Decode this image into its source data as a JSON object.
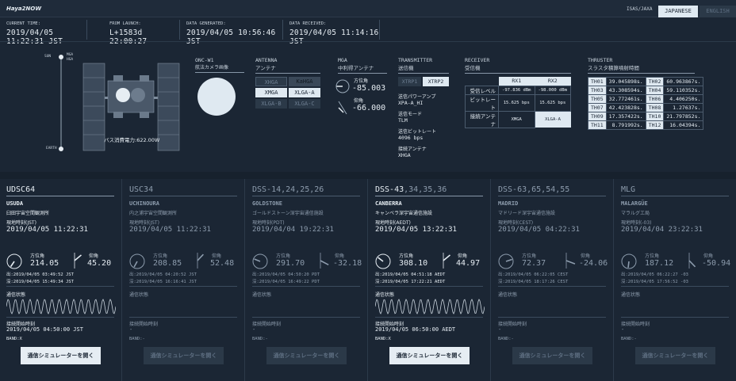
{
  "header": {
    "app_title": "Haya2NOW",
    "org": "ISAS/JAXA",
    "lang_ja": "JAPANESE",
    "lang_en": "ENGLISH"
  },
  "times": [
    {
      "label": "CURRENT TIME:",
      "value": "2019/04/05 11:22:31 JST"
    },
    {
      "label": "FROM LAUNCH:",
      "value": "L+1583d 22:00:27"
    },
    {
      "label": "DATA GENERATED:",
      "value": "2019/04/05 10:56:46 JST"
    },
    {
      "label": "DATA RECEIVED:",
      "value": "2019/04/05 11:14:16 JST"
    }
  ],
  "spacecraft": {
    "label_sun": "SUN",
    "label_mga": "MGA",
    "label_hga": "HGA",
    "label_earth": "EARTH",
    "power": "バス消費電力:622.00W"
  },
  "onc": {
    "title": "ONC-W1",
    "subtitle": "航法カメラ画像"
  },
  "antenna": {
    "title": "ANTENNA",
    "subtitle": "アンテナ",
    "buttons": [
      {
        "label": "XHGA",
        "state": "off"
      },
      {
        "label": "KaHGA",
        "state": "dim"
      },
      {
        "label": "XMGA",
        "state": "on"
      },
      {
        "label": "XLGA-A",
        "state": "on"
      },
      {
        "label": "XLGA-B",
        "state": "off"
      },
      {
        "label": "XLGA-C",
        "state": "off"
      }
    ]
  },
  "mga": {
    "title": "MGA",
    "subtitle": "中利得アンテナ",
    "az_label": "方位角",
    "az_value": "-85.003",
    "el_label": "仰角",
    "el_value": "-66.000"
  },
  "transmitter": {
    "title": "TRANSMITTER",
    "subtitle": "送信機",
    "xtrp1": "XTRP1",
    "xtrp2": "XTRP2",
    "power_label": "送信パワーアンプ",
    "power_value": "XPA-A_HI",
    "mode_label": "送信モード",
    "mode_value": "TLM",
    "bitrate_label": "送信ビットレート",
    "bitrate_value": "4096 bps",
    "antenna_label": "接続アンテナ",
    "antenna_value": "XHGA"
  },
  "receiver": {
    "title": "RECEIVER",
    "subtitle": "受信機",
    "col1": "RX1",
    "col2": "RX2",
    "rows": [
      {
        "label": "受信レベル",
        "rx1": "-97.836 dBm",
        "rx2": "-98.000 dBm"
      },
      {
        "label": "ビットレート",
        "rx1": "15.625 bps",
        "rx2": "15.625 bps"
      },
      {
        "label": "接続アンテナ",
        "rx1": "XMGA",
        "rx2": "XLGA-A"
      }
    ]
  },
  "thruster": {
    "title": "THRUSTER",
    "subtitle": "スラスタ積算噴射時間",
    "rows": [
      [
        {
          "id": "TH01",
          "v": "39.045898s."
        },
        {
          "id": "TH02",
          "v": "60.963867s."
        }
      ],
      [
        {
          "id": "TH03",
          "v": "43.308594s."
        },
        {
          "id": "TH04",
          "v": "59.110352s."
        }
      ],
      [
        {
          "id": "TH05",
          "v": "32.772461s."
        },
        {
          "id": "TH06",
          "v": "4.406250s."
        }
      ],
      [
        {
          "id": "TH07",
          "v": "42.423828s."
        },
        {
          "id": "TH08",
          "v": "1.27637s."
        }
      ],
      [
        {
          "id": "TH09",
          "v": "17.357422s."
        },
        {
          "id": "TH10",
          "v": "21.797852s."
        }
      ],
      [
        {
          "id": "TH11",
          "v": "8.791992s."
        },
        {
          "id": "TH12",
          "v": "16.04394s."
        }
      ]
    ]
  },
  "stations": [
    {
      "code": "UDSC64",
      "name": "USUDA",
      "jname": "臼田宇宙空間観測所",
      "tz": "現地時刻(JST)",
      "local_time": "2019/04/05 11:22:31",
      "az_label": "方位角",
      "az": "214.05",
      "el_label": "仰角",
      "el": "45.20",
      "rise": "出:2019/04/05 03:49:52 JST",
      "set": "沒:2019/04/05 15:49:34 JST",
      "comm_label": "通信状態",
      "start_label": "接続開始時刻",
      "start": "2019/04/05 04:50:00 JST",
      "band": "BAND:X",
      "sim_button": "通信シミュレーターを開く",
      "active": true,
      "az_deg": 214,
      "el_deg": 45
    },
    {
      "code": "USC34",
      "name": "UCHINOURA",
      "jname": "内之浦宇宙空間観測所",
      "tz": "現地時刻(JST)",
      "local_time": "2019/04/05 11:22:31",
      "az_label": "方位角",
      "az": "208.85",
      "el_label": "仰角",
      "el": "52.48",
      "rise": "出:2019/04/05 04:20:52 JST",
      "set": "沒:2019/04/05 16:16:41 JST",
      "comm_label": "通信状態",
      "start_label": "接続開始時刻",
      "start": "-",
      "band": "BAND:-",
      "sim_button": "通信シミュレーターを開く",
      "active": false,
      "az_deg": 209,
      "el_deg": 52
    },
    {
      "code": "DSS-14,24,25,26",
      "name": "GOLDSTONE",
      "jname": "ゴールドストーン深宇宙通信施設",
      "tz": "現地時刻(PDT)",
      "local_time": "2019/04/04 19:22:31",
      "az_label": "方位角",
      "az": "291.70",
      "el_label": "仰角",
      "el": "-32.18",
      "rise": "出:2019/04/05 04:50:20 PDT",
      "set": "沒:2019/04/05 16:49:22 PDT",
      "comm_label": "通信状態",
      "start_label": "接続開始時刻",
      "start": "-",
      "band": "BAND:-",
      "sim_button": "通信シミュレーターを開く",
      "active": false,
      "az_deg": 292,
      "el_deg": -32
    },
    {
      "code": "DSS-43",
      "code_rest": ",34,35,36",
      "name": "CANBERRA",
      "jname": "キャンベラ深宇宙通信施設",
      "tz": "現地時刻(AEDT)",
      "local_time": "2019/04/05 13:22:31",
      "az_label": "方位角",
      "az": "308.10",
      "el_label": "仰角",
      "el": "44.97",
      "rise": "出:2019/04/05 04:51:18 AEDT",
      "set": "沒:2019/04/05 17:22:21 AEDT",
      "comm_label": "通信状態",
      "start_label": "接続開始時刻",
      "start": "2019/04/05 06:50:00 AEDT",
      "band": "BAND:X",
      "sim_button": "通信シミュレーターを開く",
      "active": true,
      "az_deg": 308,
      "el_deg": 45
    },
    {
      "code": "DSS-63,65,54,55",
      "name": "MADRID",
      "jname": "マドリード深宇宙通信施設",
      "tz": "現地時刻(CEST)",
      "local_time": "2019/04/05 04:22:31",
      "az_label": "方位角",
      "az": "72.37",
      "el_label": "仰角",
      "el": "-24.06",
      "rise": "出:2019/04/05 06:22:05 CEST",
      "set": "沒:2019/04/05 18:17:26 CEST",
      "comm_label": "通信状態",
      "start_label": "接続開始時刻",
      "start": "-",
      "band": "BAND:-",
      "sim_button": "通信シミュレーターを開く",
      "active": false,
      "az_deg": 72,
      "el_deg": -24
    },
    {
      "code": "MLG",
      "name": "MALARGÜE",
      "jname": "マラルグエ局",
      "tz": "現地時刻(-03)",
      "local_time": "2019/04/04 23:22:31",
      "az_label": "方位角",
      "az": "187.12",
      "el_label": "仰角",
      "el": "-50.94",
      "rise": "出:2019/04/05 06:22:27 -03",
      "set": "沒:2019/04/05 17:56:52 -03",
      "comm_label": "通信状態",
      "start_label": "接続開始時刻",
      "start": "-",
      "band": "BAND:-",
      "sim_button": "通信シミュレーターを開く",
      "active": false,
      "az_deg": 187,
      "el_deg": -51
    }
  ]
}
